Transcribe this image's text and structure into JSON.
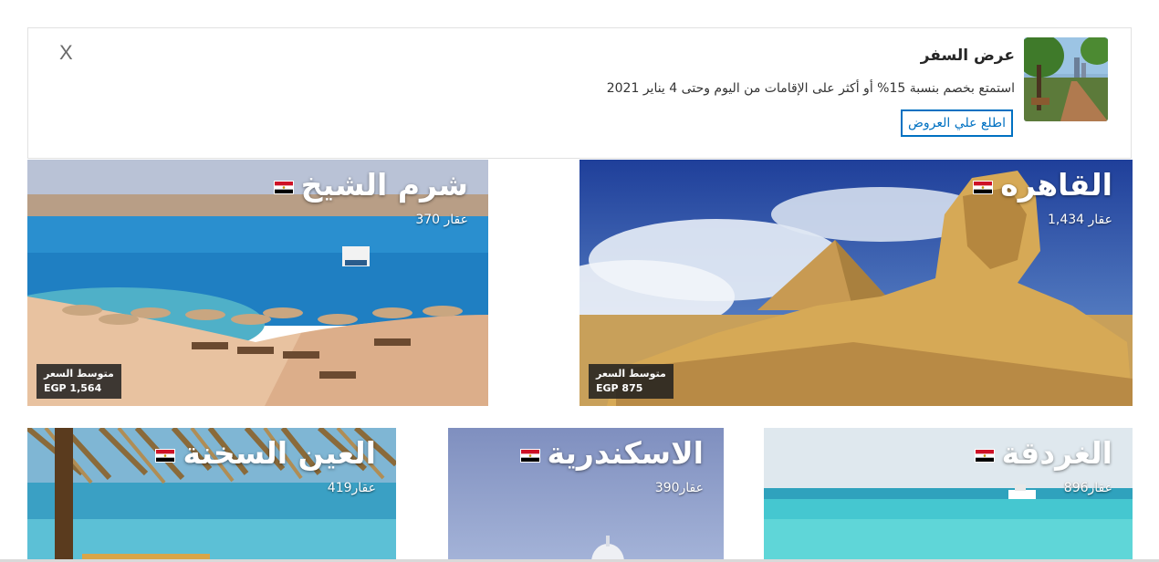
{
  "banner": {
    "close_label": "X",
    "title": "عرض السفر",
    "description": "استمتع بخصم بنسبة 15% أو أكثر على الإقامات من اليوم وحتى 4 يناير 2021",
    "button_label": "اطلع علي العروض"
  },
  "destinations": [
    {
      "name": "القاهره",
      "count": "عقار 1,434",
      "price_label": "متوسط السعر",
      "price_value": "EGP 875"
    },
    {
      "name": "شرم الشيخ",
      "count": "عقار 370",
      "price_label": "متوسط السعر",
      "price_value": "EGP 1,564"
    },
    {
      "name": "الغردقة",
      "count": "عقار896"
    },
    {
      "name": "الاسكندرية",
      "count": "عقار390"
    },
    {
      "name": "العين السخنة",
      "count": "عقار419"
    }
  ],
  "colors": {
    "accent": "#0071c2",
    "border": "#e1e1e1"
  }
}
